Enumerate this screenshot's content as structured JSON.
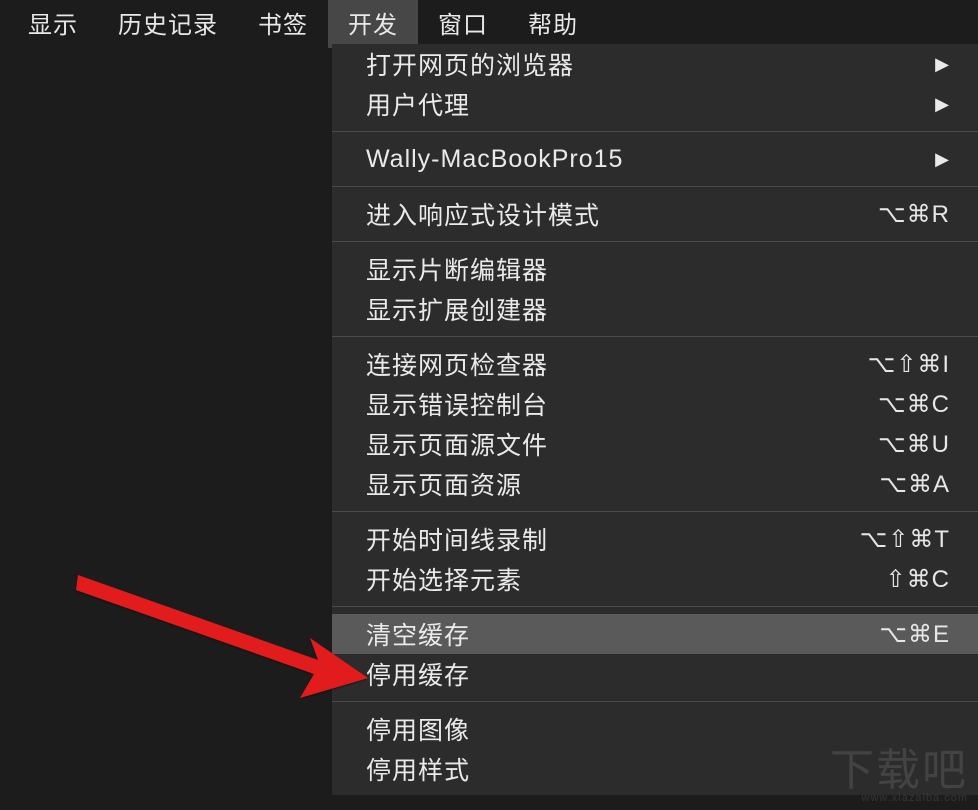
{
  "menubar": {
    "items": [
      {
        "label": "显示"
      },
      {
        "label": "历史记录"
      },
      {
        "label": "书签"
      },
      {
        "label": "开发",
        "active": true
      },
      {
        "label": "窗口"
      },
      {
        "label": "帮助"
      }
    ]
  },
  "dropdown": {
    "groups": [
      [
        {
          "label": "打开网页的浏览器",
          "submenu": true
        },
        {
          "label": "用户代理",
          "submenu": true
        }
      ],
      [
        {
          "label": "Wally-MacBookPro15",
          "submenu": true
        }
      ],
      [
        {
          "label": "进入响应式设计模式",
          "shortcut": "⌥⌘R"
        }
      ],
      [
        {
          "label": "显示片断编辑器"
        },
        {
          "label": "显示扩展创建器"
        }
      ],
      [
        {
          "label": "连接网页检查器",
          "shortcut": "⌥⇧⌘I"
        },
        {
          "label": "显示错误控制台",
          "shortcut": "⌥⌘C"
        },
        {
          "label": "显示页面源文件",
          "shortcut": "⌥⌘U"
        },
        {
          "label": "显示页面资源",
          "shortcut": "⌥⌘A"
        }
      ],
      [
        {
          "label": "开始时间线录制",
          "shortcut": "⌥⇧⌘T"
        },
        {
          "label": "开始选择元素",
          "shortcut": "⇧⌘C"
        }
      ],
      [
        {
          "label": "清空缓存",
          "shortcut": "⌥⌘E",
          "highlight": true
        },
        {
          "label": "停用缓存"
        }
      ],
      [
        {
          "label": "停用图像"
        },
        {
          "label": "停用样式"
        }
      ]
    ]
  },
  "watermark": {
    "main": "下载吧",
    "sub": "www.xiazaiba.com"
  }
}
